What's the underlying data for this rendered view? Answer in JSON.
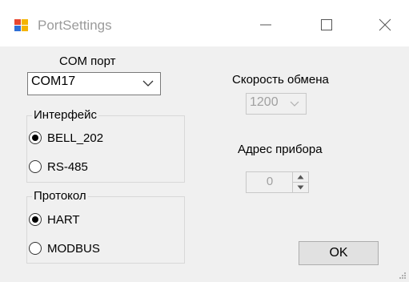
{
  "window": {
    "title": "PortSettings",
    "icon": "window-app-icon",
    "controls": [
      "minimize-icon",
      "maximize-icon",
      "close-icon"
    ]
  },
  "com_port": {
    "label": "COM порт",
    "selected": "COM17"
  },
  "interface": {
    "title": "Интерфейс",
    "options": [
      {
        "label": "BELL_202",
        "checked": true
      },
      {
        "label": "RS-485",
        "checked": false
      }
    ]
  },
  "protocol": {
    "title": "Протокол",
    "options": [
      {
        "label": "HART",
        "checked": true
      },
      {
        "label": "MODBUS",
        "checked": false
      }
    ]
  },
  "baud": {
    "label": "Скорость обмена",
    "selected": "1200",
    "disabled": true
  },
  "address": {
    "label": "Адрес прибора",
    "value": "0",
    "disabled": true
  },
  "ok_label": "OK",
  "colors": {
    "title_text": "#9b9b9b",
    "disabled_text": "#a0a0a0",
    "button_face": "#e1e1e1",
    "dialog_bg": "#f0f0f0"
  }
}
